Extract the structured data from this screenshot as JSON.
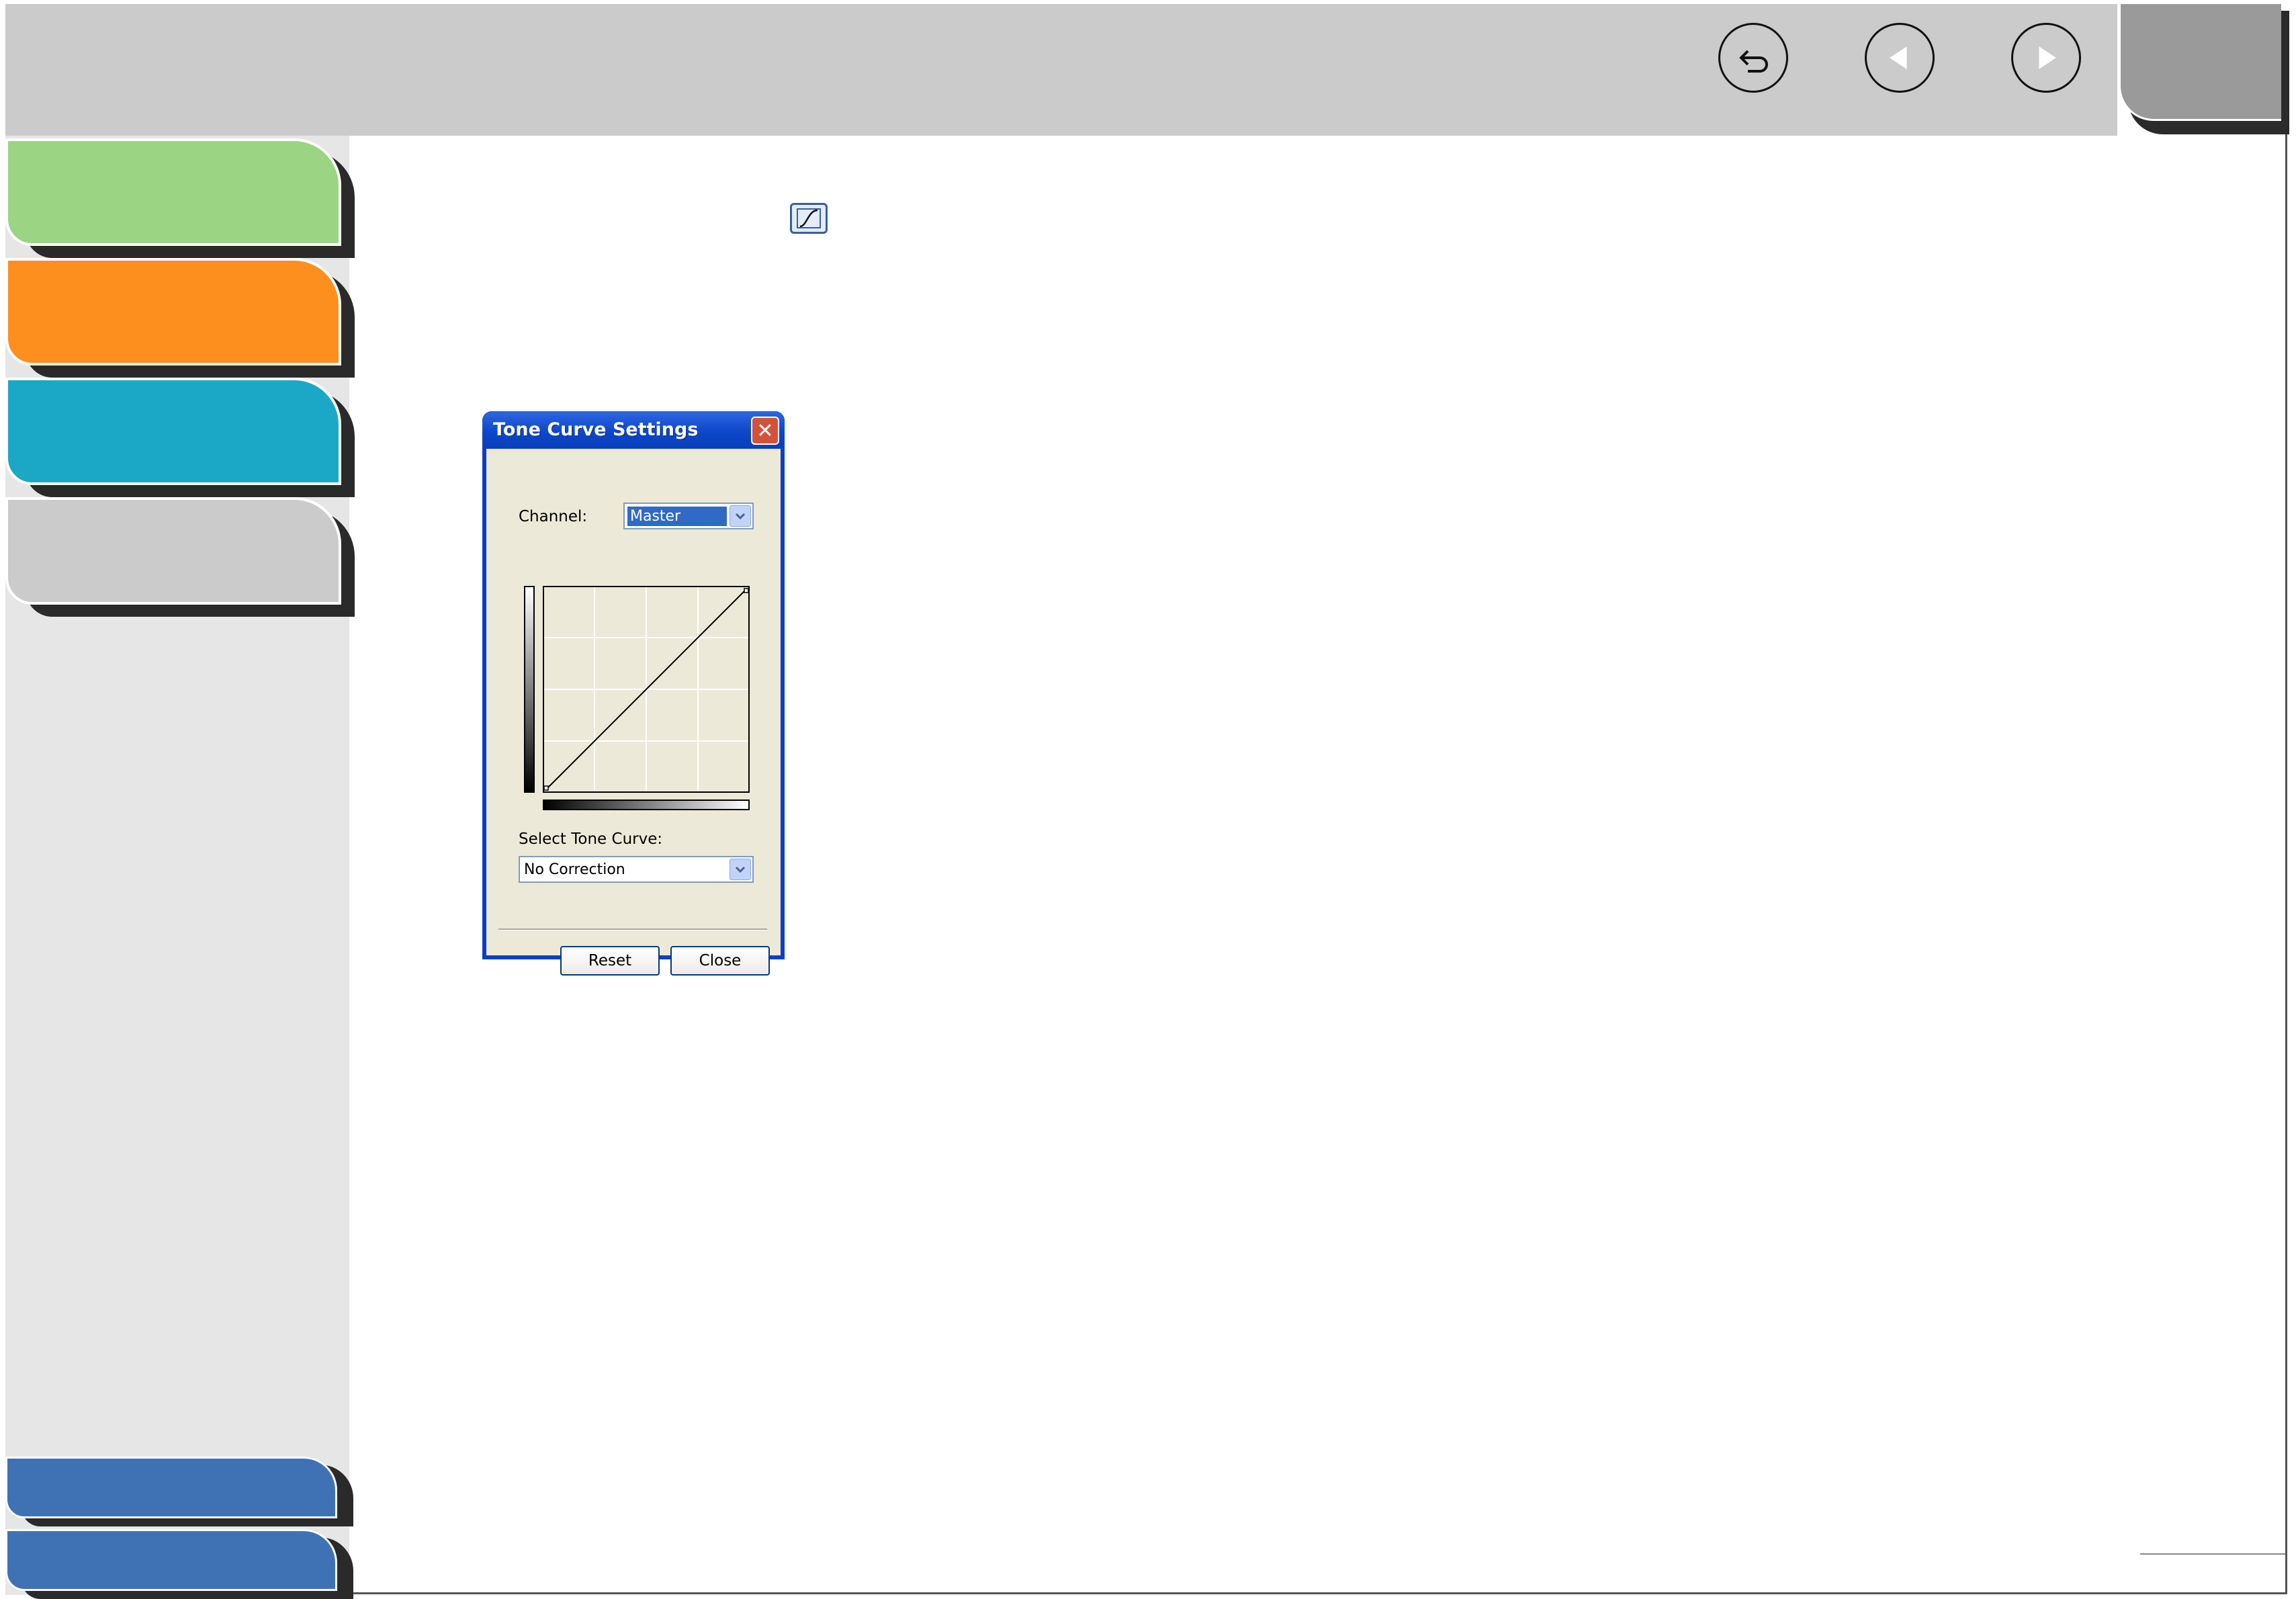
{
  "nav": {
    "back_icon": "return-arrow-icon",
    "prev_icon": "triangle-left-icon",
    "next_icon": "triangle-right-icon"
  },
  "sidebar": {
    "tabs": [
      {
        "color": "#9bd483"
      },
      {
        "color": "#fd8f1f"
      },
      {
        "color": "#1aa8c6"
      },
      {
        "color": "#cbcbcb"
      }
    ],
    "bottom_buttons_color": "#3f72b5"
  },
  "dialog": {
    "title": "Tone Curve Settings",
    "close_glyph": "✕",
    "channel_label": "Channel:",
    "channel_value": "Master",
    "select_curve_label": "Select Tone Curve:",
    "select_curve_value": "No Correction",
    "reset_label": "Reset",
    "close_label": "Close"
  }
}
